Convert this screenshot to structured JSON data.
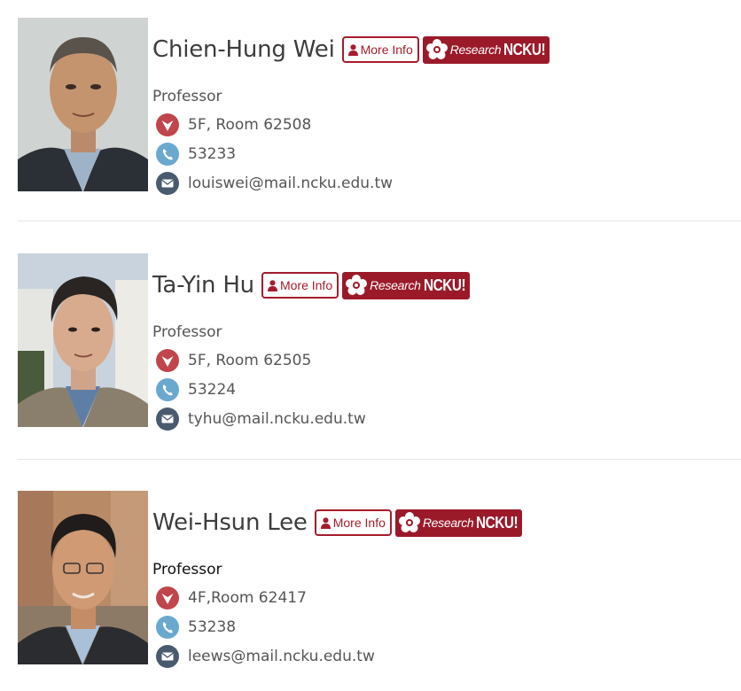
{
  "people": [
    {
      "name": "Chien-Hung Wei",
      "title": "Professor",
      "office": "5F, Room 62508",
      "phone": "53233",
      "email": "louiswei@mail.ncku.edu.tw"
    },
    {
      "name": "Ta-Yin Hu",
      "title": "Professor",
      "office": "5F, Room 62505",
      "phone": "53224",
      "email": "tyhu@mail.ncku.edu.tw"
    },
    {
      "name": "Wei-Hsun Lee",
      "title": "Professor",
      "office": "4F,Room 62417",
      "phone": "53238",
      "email": "leews@mail.ncku.edu.tw"
    }
  ],
  "buttons": {
    "more_info": "More Info",
    "research_word": "Research",
    "research_brand": "NCKU!"
  },
  "icons": {
    "location": "location-pin-icon",
    "phone": "phone-icon",
    "email": "email-icon",
    "user": "user-icon",
    "flower": "ncku-flower-logo-icon"
  },
  "colors": {
    "brand_red": "#9b1a2a",
    "location_icon": "#c0454d",
    "phone_icon": "#6aa8d0",
    "email_icon": "#4a5a6e",
    "text": "#555555"
  }
}
